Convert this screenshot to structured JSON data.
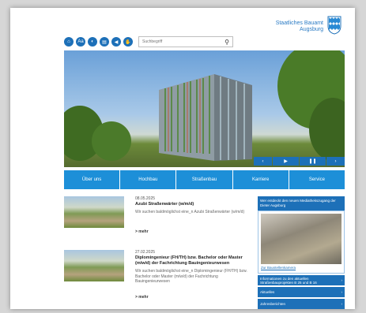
{
  "logo": {
    "line1": "Staatliches Bauamt",
    "line2": "Augsburg"
  },
  "toolbar": {
    "buttons": [
      {
        "glyph": "⌂",
        "icon": "home-icon"
      },
      {
        "glyph": "Aa",
        "icon": "font-size-icon"
      },
      {
        "glyph": "◐",
        "icon": "contrast-icon"
      },
      {
        "glyph": "▤",
        "icon": "print-icon"
      },
      {
        "glyph": "◀",
        "icon": "speaker-icon"
      },
      {
        "glyph": "✋",
        "icon": "sign-language-icon"
      }
    ]
  },
  "search": {
    "placeholder": "Suchbegriff",
    "icon": "search-icon"
  },
  "hero": {
    "controls": {
      "prev": "‹",
      "play": "▶",
      "pause": "❚❚",
      "next": "›"
    }
  },
  "nav": {
    "items": [
      "Über uns",
      "Hochbau",
      "Straßenbau",
      "Karriere",
      "Service"
    ]
  },
  "news": [
    {
      "date": "08.05.2025",
      "title": "Azubi Straßenwärter (w/m/d)",
      "text": "Wir suchen baldmöglichst eine_n Azubi Straßenwärter (w/m/d)",
      "more": "> mehr"
    },
    {
      "date": "27.02.2025",
      "title": "Diplomingenieur (FH/TH) bzw. Bachelor oder Master (m/w/d) der Fachrichtung Bauingenieurwesen",
      "text": "Wir suchen baldmöglichst eine_n Diplomingenieur (FH/TH) bzw. Bachelor oder Master (m/w/d) der Fachrichtung Bauingenieurwesen",
      "more": "> mehr"
    }
  ],
  "sidebar": {
    "header": "Wer entdeckt den neuen Mediathekszugang der Dieter Augsburg",
    "link": "Zur Baustellenkamera",
    "items": [
      {
        "label": "Informationen zu den aktuellen Straßenbauprojekten B 25 und B 16",
        "arrow": "›"
      },
      {
        "label": "Aktuelles",
        "arrow": "›"
      },
      {
        "label": "Jahresberichten",
        "arrow": "›"
      }
    ]
  }
}
